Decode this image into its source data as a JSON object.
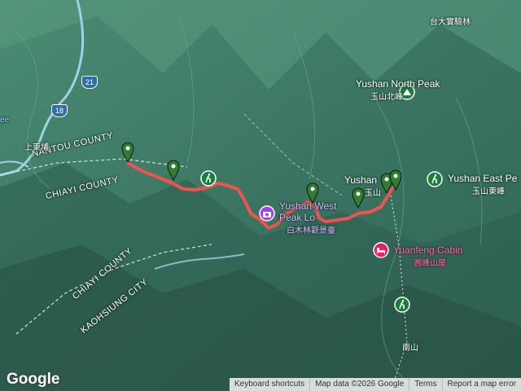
{
  "map": {
    "labels": {
      "nantou_county": "NANTOU COUNTY",
      "chiayi_county_upper": "CHIAYI COUNTY",
      "chiayi_county_lower": "CHIAYI COUNTY",
      "kaohsiung_city": "KAOHSIUNG CITY",
      "dongpu": "上東埔",
      "forest": "台大實驗林",
      "ee": "ee",
      "south_mountain": "南山"
    },
    "roads": {
      "r21": "21",
      "r18": "18"
    },
    "pois": {
      "north_peak_en": "Yushan North Peak",
      "north_peak_zh": "玉山北峰",
      "main_peak_en": "Yushan",
      "main_peak_zh": "玉山",
      "east_peak_en": "Yushan East Pe",
      "east_peak_zh": "玉山東峰",
      "west_peak_en": "Yushan West",
      "west_peak_en2": "Peak Lo",
      "west_peak_zh": "白木林觀景臺",
      "cabin_en": "Yuanfeng Cabin",
      "cabin_zh": "圓峰山屋"
    },
    "colors": {
      "route": "#ef5350",
      "marker": "#2e7d32",
      "poi_green": "#188038",
      "poi_purple": "#a142f4",
      "poi_pink": "#e91e63",
      "terrain": "#3e7a66"
    },
    "icons": {
      "marker": "map-pin-icon",
      "peak": "mountain-peak-icon",
      "hiking": "hiking-icon",
      "viewpoint": "camera-icon",
      "lodging": "bed-icon"
    }
  },
  "footer": {
    "logo": "Google",
    "keyboard": "Keyboard shortcuts",
    "data": "Map data ©2026 Google",
    "terms": "Terms",
    "report": "Report a map error"
  }
}
